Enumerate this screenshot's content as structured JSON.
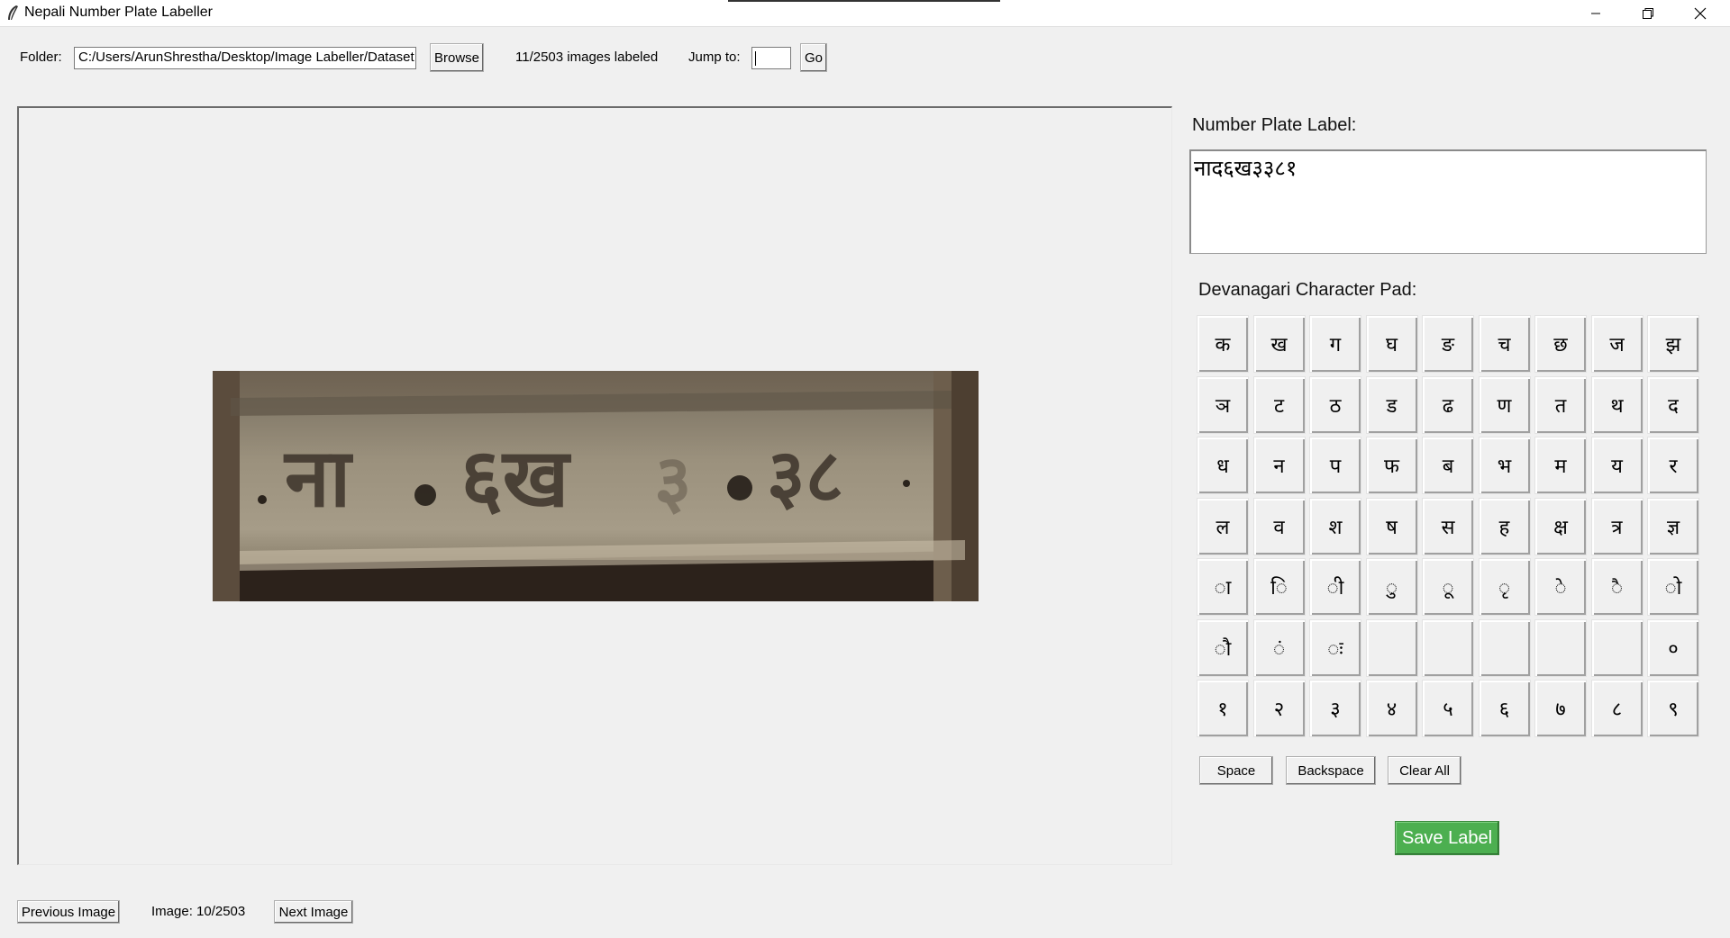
{
  "window": {
    "title": "Nepali Number Plate Labeller"
  },
  "toolbar": {
    "folder_label": "Folder:",
    "folder_path": "C:/Users/ArunShrestha/Desktop/Image Labeller/Dataset",
    "browse_label": "Browse",
    "progress_text": "11/2503 images labeled",
    "jump_label": "Jump to:",
    "jump_value": "",
    "go_label": "Go"
  },
  "right_panel": {
    "label_title": "Number Plate Label:",
    "label_value": "नाद६ख३३८१",
    "pad_title": "Devanagari Character Pad:",
    "rows": [
      [
        "क",
        "ख",
        "ग",
        "घ",
        "ङ",
        "च",
        "छ",
        "ज",
        "झ"
      ],
      [
        "ञ",
        "ट",
        "ठ",
        "ड",
        "ढ",
        "ण",
        "त",
        "थ",
        "द"
      ],
      [
        "ध",
        "न",
        "प",
        "फ",
        "ब",
        "भ",
        "म",
        "य",
        "र"
      ],
      [
        "ल",
        "व",
        "श",
        "ष",
        "स",
        "ह",
        "क्ष",
        "त्र",
        "ज्ञ"
      ],
      [
        "ा",
        "ि",
        "ी",
        "ु",
        "ू",
        "ृ",
        "े",
        "ै",
        "ो"
      ],
      [
        "ौ",
        "ं",
        "ः",
        "",
        "",
        "",
        "",
        "",
        "०"
      ],
      [
        "१",
        "२",
        "३",
        "४",
        "५",
        "६",
        "७",
        "८",
        "९"
      ]
    ],
    "space_label": "Space",
    "backspace_label": "Backspace",
    "clear_label": "Clear All",
    "save_label": "Save Label"
  },
  "footer": {
    "prev_label": "Previous Image",
    "image_counter": "Image: 10/2503",
    "next_label": "Next Image"
  },
  "colors": {
    "save_button": "#4caf50",
    "window_bg": "#f0f0f0"
  }
}
